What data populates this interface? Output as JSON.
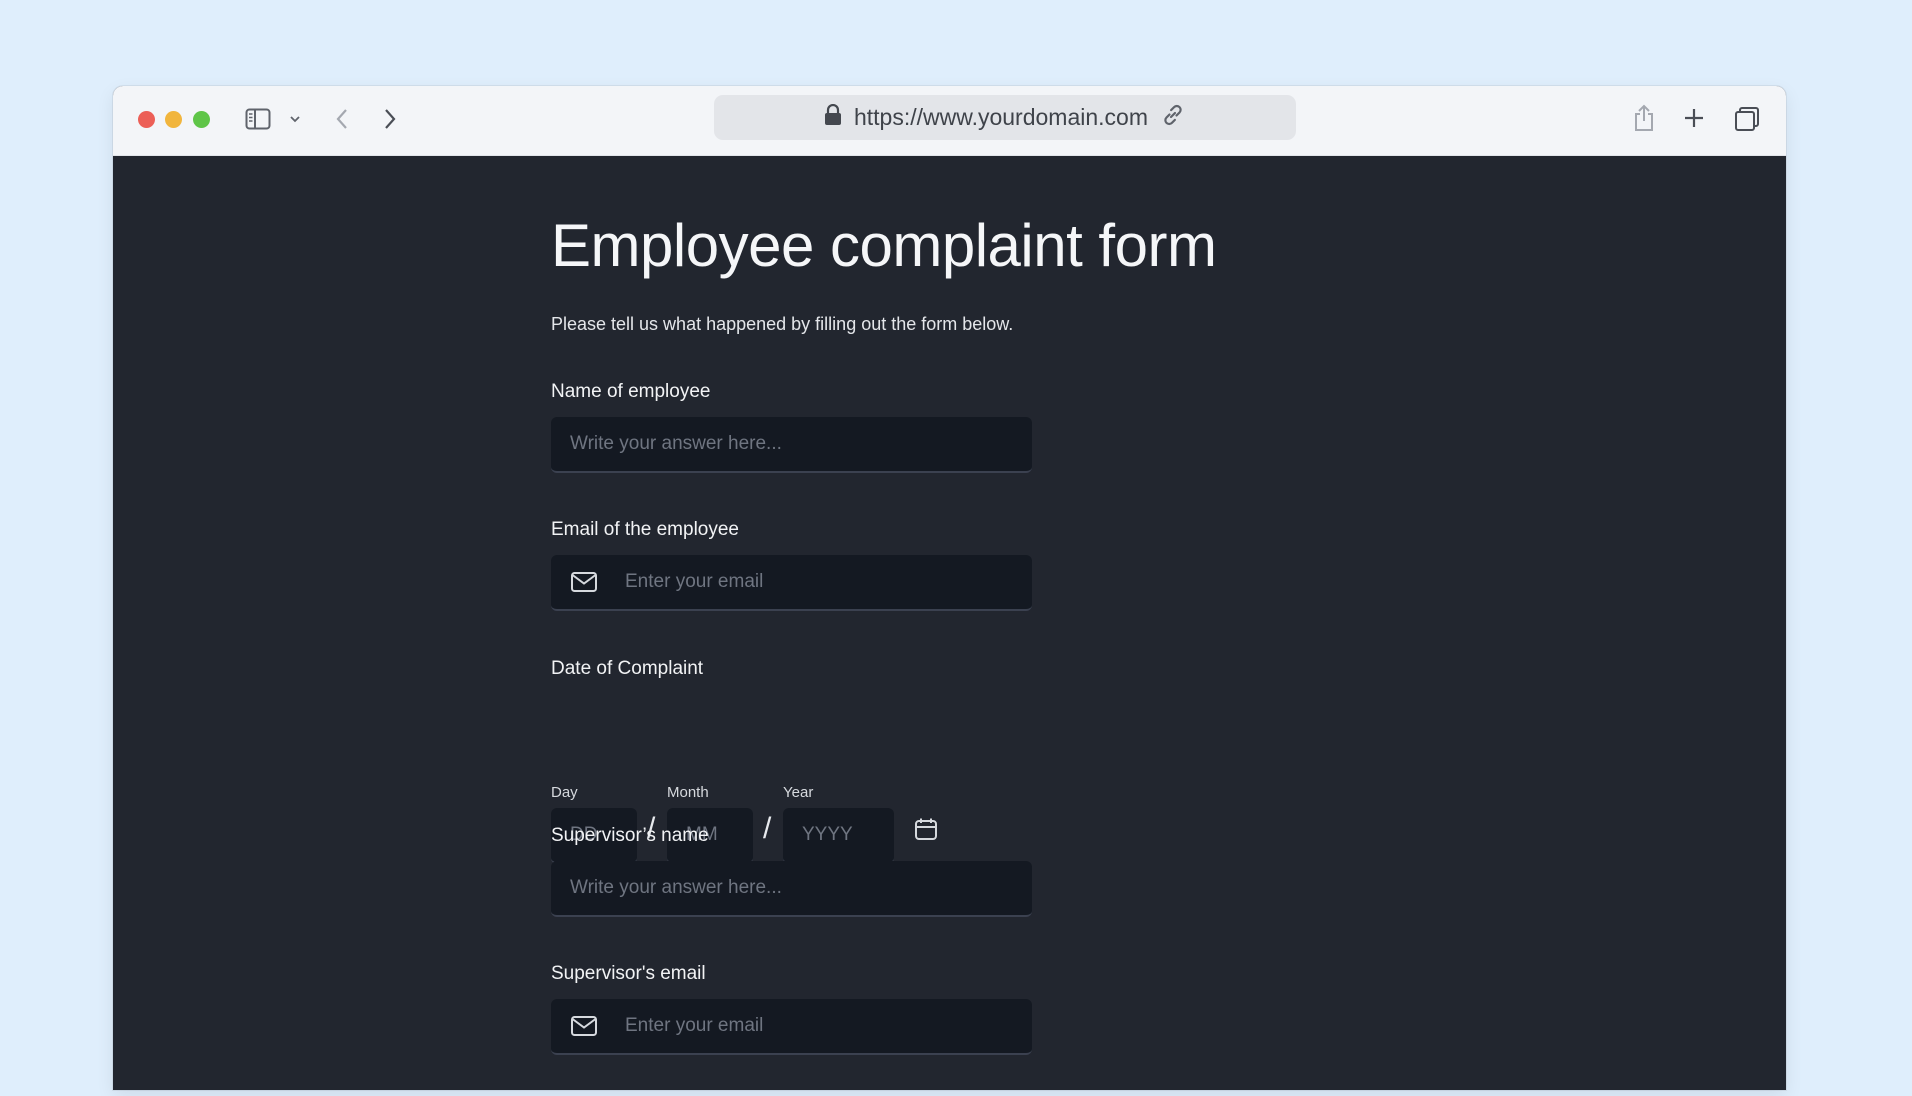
{
  "browser": {
    "url": "https://www.yourdomain.com",
    "icons": [
      "sidebar-icon",
      "chevron-down-icon",
      "back-icon",
      "forward-icon",
      "lock-icon",
      "link-icon",
      "share-icon",
      "plus-icon",
      "tabs-icon"
    ]
  },
  "form": {
    "title": "Employee complaint form",
    "subtitle": "Please tell us what happened by filling out the form below.",
    "name_label": "Name of employee",
    "name_placeholder": "Write your answer here...",
    "email_label": "Email of the employee",
    "email_placeholder": "Enter your email",
    "date_label": "Date of Complaint",
    "day_label": "Day",
    "month_label": "Month",
    "year_label": "Year",
    "day_placeholder": "DD",
    "month_placeholder": "MM",
    "year_placeholder": "YYYY",
    "separator": "/",
    "supervisor_name_label": "Supervisor’s name",
    "supervisor_name_placeholder": "Write your answer here...",
    "supervisor_email_label": "Supervisor's email",
    "supervisor_email_placeholder": "Enter your email"
  },
  "colors": {
    "page_bg": "#dfeefc",
    "form_bg": "#22262f",
    "input_bg": "#141922",
    "toolbar_bg": "#f3f5f8"
  }
}
